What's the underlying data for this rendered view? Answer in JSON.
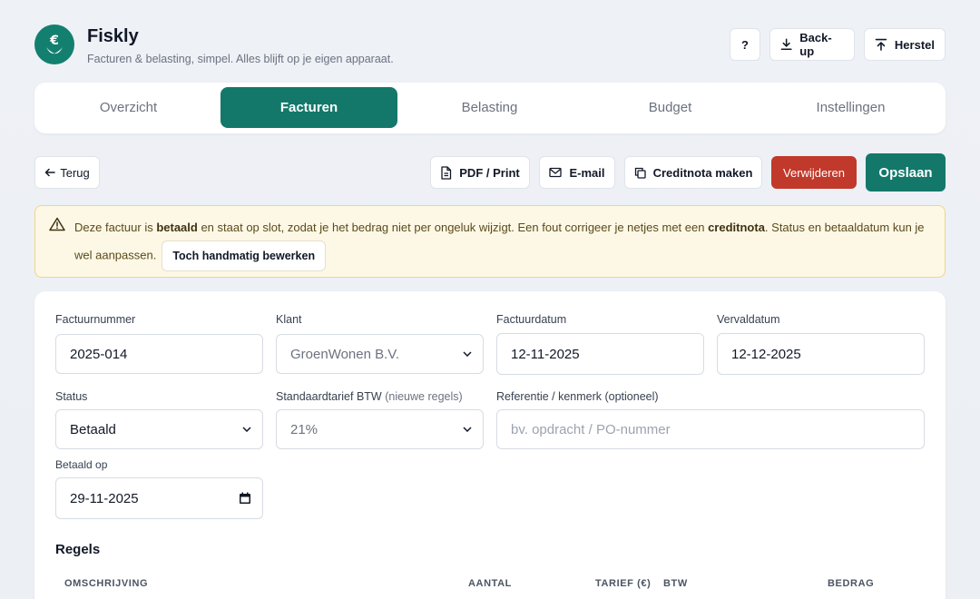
{
  "app": {
    "title": "Fiskly",
    "subtitle": "Facturen & belasting, simpel. Alles blijft op je eigen apparaat."
  },
  "header_buttons": {
    "help": "?",
    "backup": "Back-up",
    "restore": "Herstel"
  },
  "tabs": [
    {
      "label": "Overzicht",
      "active": false
    },
    {
      "label": "Facturen",
      "active": true
    },
    {
      "label": "Belasting",
      "active": false
    },
    {
      "label": "Budget",
      "active": false
    },
    {
      "label": "Instellingen",
      "active": false
    }
  ],
  "actions": {
    "back": "Terug",
    "pdf": "PDF / Print",
    "email": "E-mail",
    "credit": "Creditnota maken",
    "delete": "Verwijderen",
    "save": "Opslaan"
  },
  "banner": {
    "t1": "Deze factuur is ",
    "b1": "betaald",
    "t2": " en staat op slot, zodat je het bedrag niet per ongeluk wijzigt. Een fout corrigeer je netjes met een ",
    "b2": "creditnota",
    "t3": ". Status en betaaldatum kun je wel aanpassen.",
    "button": "Toch handmatig bewerken"
  },
  "form": {
    "invoice_number": {
      "label": "Factuurnummer",
      "value": "2025-014"
    },
    "client": {
      "label": "Klant",
      "value": "GroenWonen B.V."
    },
    "invoice_date": {
      "label": "Factuurdatum",
      "value": "12-11-2025"
    },
    "due_date": {
      "label": "Vervaldatum",
      "value": "12-12-2025"
    },
    "status": {
      "label": "Status",
      "value": "Betaald"
    },
    "vat_rate": {
      "label": "Standaardtarief BTW",
      "label_note": "(nieuwe regels)",
      "value": "21%"
    },
    "reference": {
      "label": "Referentie / kenmerk (optioneel)",
      "placeholder": "bv. opdracht / PO-nummer"
    },
    "paid_on": {
      "label": "Betaald op",
      "value": "29-11-2025"
    }
  },
  "lines": {
    "title": "Regels",
    "columns": [
      "OMSCHRIJVING",
      "AANTAL",
      "TARIEF (€)",
      "BTW",
      "BEDRAG"
    ]
  },
  "colors": {
    "brand": "#13786a",
    "danger": "#c0392b",
    "warning_bg": "#fdf8e6",
    "warning_border": "#f2d48a"
  }
}
